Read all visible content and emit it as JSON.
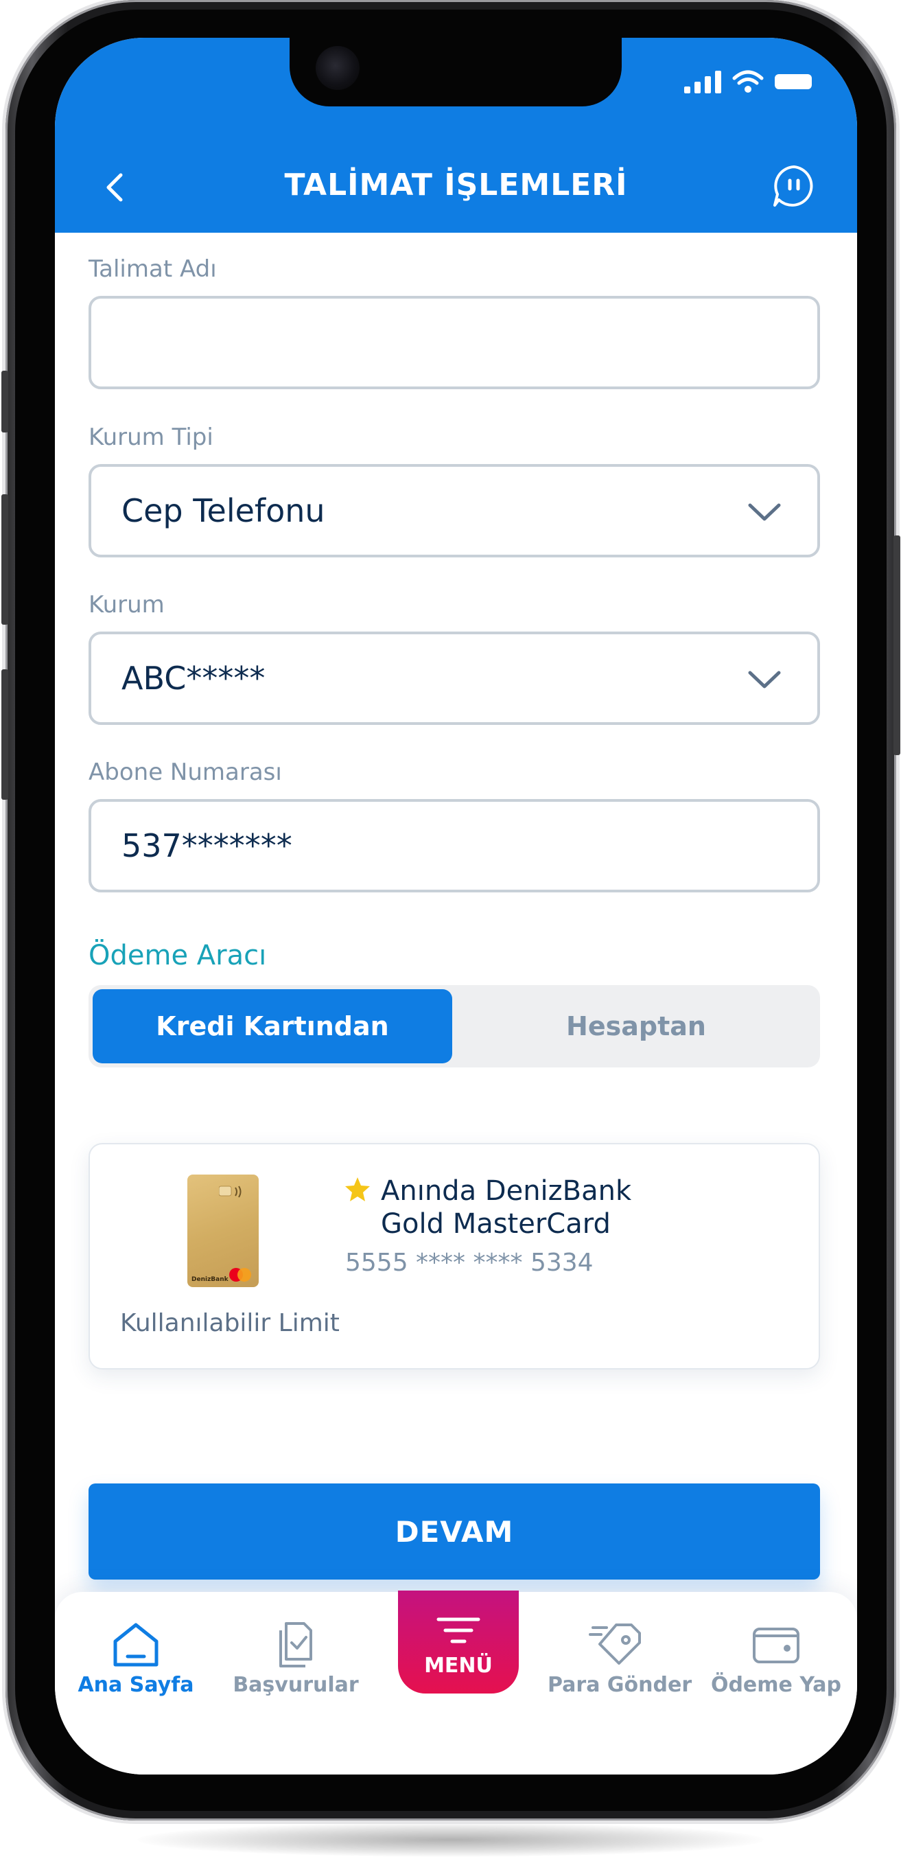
{
  "header": {
    "title": "TALİMAT İŞLEMLERİ"
  },
  "form": {
    "instruction_name_label": "Talimat Adı",
    "instruction_name_value": "",
    "institution_type_label": "Kurum Tipi",
    "institution_type_value": "Cep Telefonu",
    "institution_label": "Kurum",
    "institution_value": "ABC*****",
    "subscriber_label": "Abone Numarası",
    "subscriber_value": "537*******"
  },
  "payment": {
    "section_title": "Ödeme Aracı",
    "tabs": [
      {
        "label": "Kredi Kartından",
        "active": true
      },
      {
        "label": "Hesaptan",
        "active": false
      }
    ],
    "card": {
      "name_line1": "Anında DenizBank",
      "name_line2": "Gold MasterCard",
      "number": "5555 **** **** 5334",
      "limit_label": "Kullanılabilir Limit",
      "brand_mark": "DenizBank"
    }
  },
  "actions": {
    "continue_label": "DEVAM"
  },
  "bottom_nav": {
    "items": [
      {
        "label": "Ana Sayfa",
        "icon": "home-icon",
        "active": true
      },
      {
        "label": "Başvurular",
        "icon": "document-check-icon",
        "active": false
      },
      {
        "label": "MENÜ",
        "icon": "menu-icon",
        "active": false
      },
      {
        "label": "Para Gönder",
        "icon": "send-money-icon",
        "active": false
      },
      {
        "label": "Ödeme Yap",
        "icon": "wallet-icon",
        "active": false
      }
    ]
  },
  "colors": {
    "primary": "#0f7de3",
    "accent_teal": "#18a2b8",
    "menu_gradient_top": "#c4127f",
    "menu_gradient_bottom": "#e5114f",
    "text_dark": "#0d2b4f",
    "text_muted": "#7f93a8"
  }
}
